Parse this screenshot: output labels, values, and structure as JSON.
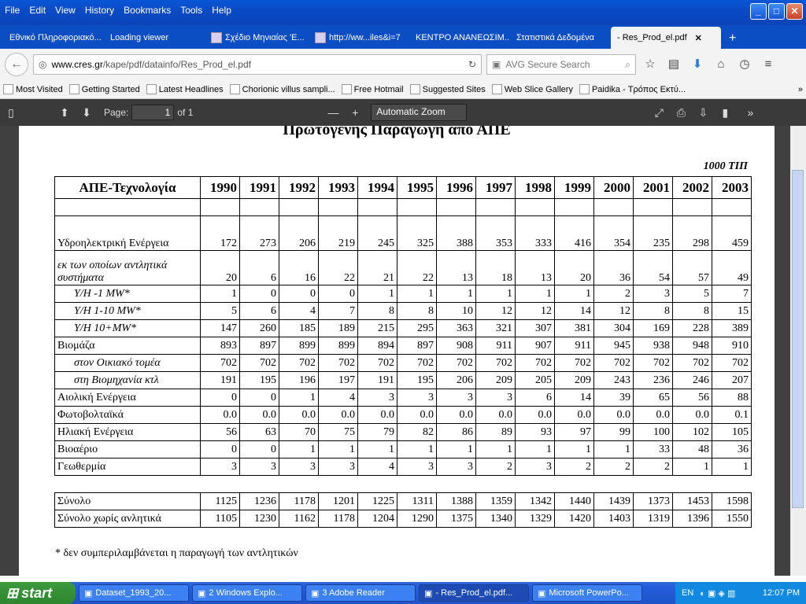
{
  "menu": [
    "File",
    "Edit",
    "View",
    "History",
    "Bookmarks",
    "Tools",
    "Help"
  ],
  "tabs": [
    {
      "label": "Εθνικό Πληροφοριακό..."
    },
    {
      "label": "Loading viewer"
    },
    {
      "label": "Σχέδιο Μηνιαίας 'Ε..."
    },
    {
      "label": "http://ww...iles&i=7"
    },
    {
      "label": "ΚΕΝΤΡΟ ΑΝΑΝΕΩΣΙΜ..."
    },
    {
      "label": "Στατιστικά Δεδομένα"
    },
    {
      "label": "- Res_Prod_el.pdf"
    }
  ],
  "url": {
    "host": "www.cres.gr",
    "path": "/kape/pdf/datainfo/Res_Prod_el.pdf"
  },
  "search_placeholder": "AVG Secure Search",
  "bookmarks": [
    "Most Visited",
    "Getting Started",
    "Latest Headlines",
    "Chorionic villus sampli...",
    "Free Hotmail",
    "Suggested Sites",
    "Web Slice Gallery",
    "Paidika - Τρόπος Εκτύ..."
  ],
  "pdf": {
    "page_label": "Page:",
    "page_value": "1",
    "page_of": "of 1",
    "zoom": "Automatic Zoom"
  },
  "doc": {
    "title": "Πρωτογενής Παραγωγή από ΑΠΕ",
    "unit": "1000 ΤΙΠ",
    "header": [
      "ΑΠΕ-Τεχνολογία",
      "1990",
      "1991",
      "1992",
      "1993",
      "1994",
      "1995",
      "1996",
      "1997",
      "1998",
      "1999",
      "2000",
      "2001",
      "2002",
      "2003"
    ],
    "rows": [
      {
        "label": "",
        "cells": [
          "",
          "",
          "",
          "",
          "",
          "",
          "",
          "",
          "",
          "",
          "",
          "",
          "",
          ""
        ],
        "style": "blank"
      },
      {
        "label": "Υδροηλεκτρική Ενέργεια",
        "cells": [
          "172",
          "273",
          "206",
          "219",
          "245",
          "325",
          "388",
          "353",
          "333",
          "416",
          "354",
          "235",
          "298",
          "459"
        ],
        "style": "tall"
      },
      {
        "label": "εκ των οποίων αντλητικά συστήματα",
        "cells": [
          "20",
          "6",
          "16",
          "22",
          "21",
          "22",
          "13",
          "18",
          "13",
          "20",
          "36",
          "54",
          "57",
          "49"
        ],
        "style": "italic tall"
      },
      {
        "label": "Υ/Η -1 MW*",
        "cells": [
          "1",
          "0",
          "0",
          "0",
          "1",
          "1",
          "1",
          "1",
          "1",
          "1",
          "2",
          "3",
          "5",
          "7"
        ],
        "style": "italic indent"
      },
      {
        "label": "Υ/Η 1-10 MW*",
        "cells": [
          "5",
          "6",
          "4",
          "7",
          "8",
          "8",
          "10",
          "12",
          "12",
          "14",
          "12",
          "8",
          "8",
          "15"
        ],
        "style": "italic indent"
      },
      {
        "label": "Υ/Η 10+MW*",
        "cells": [
          "147",
          "260",
          "185",
          "189",
          "215",
          "295",
          "363",
          "321",
          "307",
          "381",
          "304",
          "169",
          "228",
          "389"
        ],
        "style": "italic indent"
      },
      {
        "label": "Βιομάζα",
        "cells": [
          "893",
          "897",
          "899",
          "899",
          "894",
          "897",
          "908",
          "911",
          "907",
          "911",
          "945",
          "938",
          "948",
          "910"
        ],
        "style": ""
      },
      {
        "label": "στον Οικιακό τομέα",
        "cells": [
          "702",
          "702",
          "702",
          "702",
          "702",
          "702",
          "702",
          "702",
          "702",
          "702",
          "702",
          "702",
          "702",
          "702"
        ],
        "style": "italic indent"
      },
      {
        "label": "στη Βιομηχανία κτλ",
        "cells": [
          "191",
          "195",
          "196",
          "197",
          "191",
          "195",
          "206",
          "209",
          "205",
          "209",
          "243",
          "236",
          "246",
          "207"
        ],
        "style": "italic indent"
      },
      {
        "label": "Αιολική Ενέργεια",
        "cells": [
          "0",
          "0",
          "1",
          "4",
          "3",
          "3",
          "3",
          "3",
          "6",
          "14",
          "39",
          "65",
          "56",
          "88"
        ],
        "style": ""
      },
      {
        "label": "Φωτοβολταϊκά",
        "cells": [
          "0.0",
          "0.0",
          "0.0",
          "0.0",
          "0.0",
          "0.0",
          "0.0",
          "0.0",
          "0.0",
          "0.0",
          "0.0",
          "0.0",
          "0.0",
          "0.1"
        ],
        "style": ""
      },
      {
        "label": "Ηλιακή Ενέργεια",
        "cells": [
          "56",
          "63",
          "70",
          "75",
          "79",
          "82",
          "86",
          "89",
          "93",
          "97",
          "99",
          "100",
          "102",
          "105"
        ],
        "style": ""
      },
      {
        "label": "Βιοαέριο",
        "cells": [
          "0",
          "0",
          "1",
          "1",
          "1",
          "1",
          "1",
          "1",
          "1",
          "1",
          "1",
          "33",
          "48",
          "36"
        ],
        "style": ""
      },
      {
        "label": "Γεωθερμία",
        "cells": [
          "3",
          "3",
          "3",
          "3",
          "4",
          "3",
          "3",
          "2",
          "3",
          "2",
          "2",
          "2",
          "1",
          "1"
        ],
        "style": ""
      },
      {
        "label": "",
        "cells": [
          "",
          "",
          "",
          "",
          "",
          "",
          "",
          "",
          "",
          "",
          "",
          "",
          "",
          ""
        ],
        "style": "gap"
      },
      {
        "label": "Σύνολο",
        "cells": [
          "1125",
          "1236",
          "1178",
          "1201",
          "1225",
          "1311",
          "1388",
          "1359",
          "1342",
          "1440",
          "1439",
          "1373",
          "1453",
          "1598"
        ],
        "style": ""
      },
      {
        "label": "Σύνολο χωρίς ανλητικά",
        "cells": [
          "1105",
          "1230",
          "1162",
          "1178",
          "1204",
          "1290",
          "1375",
          "1340",
          "1329",
          "1420",
          "1403",
          "1319",
          "1396",
          "1550"
        ],
        "style": ""
      }
    ],
    "footnote": "* δεν συμπεριλαμβάνεται η παραγωγή των αντλητικών"
  },
  "taskbar": {
    "start": "start",
    "tasks": [
      "Dataset_1993_20...",
      "2 Windows Explo...",
      "3 Adobe Reader",
      "- Res_Prod_el.pdf...",
      "Microsoft PowerPo..."
    ],
    "lang": "EN",
    "clock": "12:07 PM"
  }
}
